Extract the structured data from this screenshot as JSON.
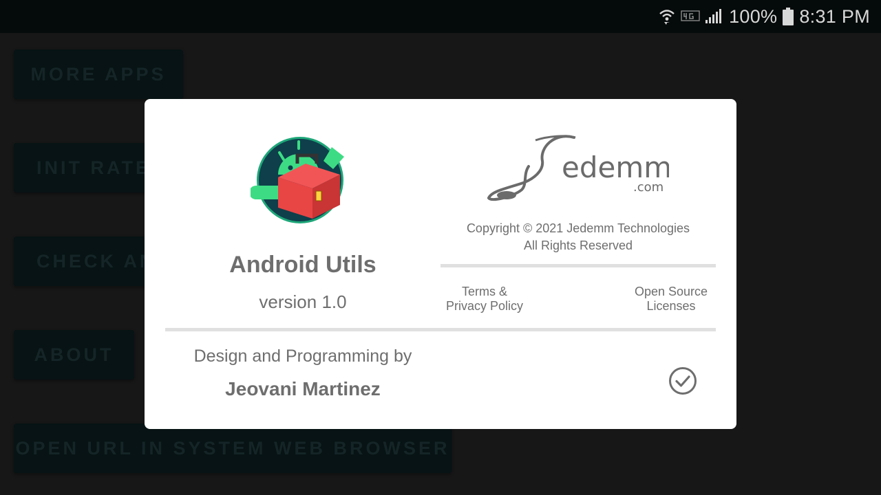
{
  "status_bar": {
    "battery": "100%",
    "time": "8:31 PM",
    "icons": [
      "wifi-calling-icon",
      "volte-4g-icon",
      "signal-icon",
      "battery-icon"
    ]
  },
  "background_buttons": [
    {
      "label": "MORE APPS"
    },
    {
      "label": "INIT RATE"
    },
    {
      "label": "CHECK AN"
    },
    {
      "label": "ABOUT"
    },
    {
      "label": "OPEN URL IN SYSTEM WEB BROWSER"
    }
  ],
  "dialog": {
    "app_name": "Android Utils",
    "version": "version 1.0",
    "brand": {
      "name": "edemm",
      "domain": ".com"
    },
    "copyright_line1": "Copyright © 2021 Jedemm Technologies",
    "copyright_line2": "All Rights Reserved",
    "terms_line1": "Terms &",
    "terms_line2": "Privacy Policy",
    "oss_line1": "Open Source",
    "oss_line2": "Licenses",
    "design_label": "Design and Programming by",
    "author": "Jeovani Martinez"
  },
  "colors": {
    "background": "#1f1f1f",
    "button_bg": "#0a1a1b",
    "dialog_text": "#6e6e6e",
    "divider": "#e0e0e0",
    "android_green": "#3ddc84",
    "toolbox_red": "#e84545"
  }
}
